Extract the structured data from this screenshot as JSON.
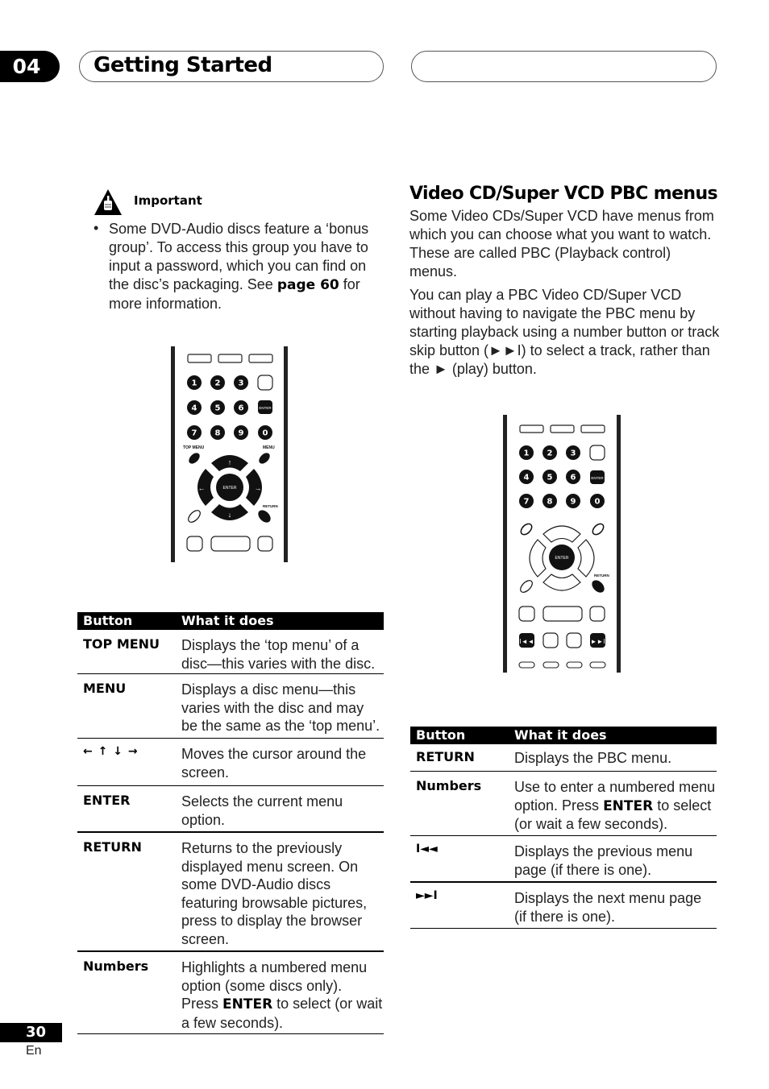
{
  "header": {
    "chapter_number": "04",
    "chapter_title": "Getting Started"
  },
  "important": {
    "icon": "warning-hand-icon",
    "label": "Important",
    "bullet": "•",
    "text_before": "Some DVD-Audio discs feature a ‘bonus group’. To access this group you have to input a password, which you can find on the disc’s packaging. See ",
    "text_bold": "page 60",
    "text_after": " for more information."
  },
  "remote_left": {
    "labels": {
      "top_menu": "TOP MENU",
      "menu": "MENU",
      "enter_small": "ENTER",
      "enter_center": "ENTER",
      "return": "RETURN"
    },
    "number_keys": [
      "1",
      "2",
      "3",
      "4",
      "5",
      "6",
      "7",
      "8",
      "9",
      "0"
    ]
  },
  "table_left": {
    "headers": [
      "Button",
      "What it does"
    ],
    "rows": [
      {
        "button": "TOP MENU",
        "desc": "Displays the ‘top menu’ of a disc—this varies with the disc."
      },
      {
        "button": "MENU",
        "desc": "Displays a disc menu—this varies with the disc and may be the same as the ‘top menu’."
      },
      {
        "button": "← ↑ ↓ →",
        "button_icon": "arrow-keys-icon",
        "desc": "Moves the cursor around the screen."
      },
      {
        "button": "ENTER",
        "desc": "Selects the current menu option."
      },
      {
        "button": "RETURN",
        "desc": "Returns to the previously displayed menu screen. On some DVD-Audio discs featuring browsable pictures, press to display the browser screen."
      },
      {
        "button": "Numbers",
        "desc_before": "Highlights a numbered menu option (some discs only). Press ",
        "desc_bold": "ENTER",
        "desc_after": " to select (or wait a few seconds)."
      }
    ]
  },
  "section": {
    "heading": "Video CD/Super VCD PBC menus",
    "para1": "Some Video CDs/Super VCD have menus from which you can choose what you want to watch. These are called PBC (Playback control) menus.",
    "para2": "You can play a PBC Video CD/Super VCD without having to navigate the PBC menu by starting playback using a number button or track skip button (►►I) to select a track, rather than the ► (play) button."
  },
  "remote_right": {
    "labels": {
      "enter_small": "ENTER",
      "enter_center": "ENTER",
      "return": "RETURN"
    },
    "number_keys": [
      "1",
      "2",
      "3",
      "4",
      "5",
      "6",
      "7",
      "8",
      "9",
      "0"
    ]
  },
  "table_right": {
    "headers": [
      "Button",
      "What it does"
    ],
    "rows": [
      {
        "button": "RETURN",
        "desc": "Displays the PBC menu."
      },
      {
        "button": "Numbers",
        "desc_before": "Use to enter a numbered menu option. Press ",
        "desc_bold": "ENTER",
        "desc_after": " to select (or wait a few seconds)."
      },
      {
        "button": "I◄◄",
        "button_icon": "previous-track-icon",
        "desc": "Displays the previous menu page (if there is one)."
      },
      {
        "button": "►►I",
        "button_icon": "next-track-icon",
        "desc": "Displays the next menu page (if there is one)."
      }
    ]
  },
  "footer": {
    "page_number": "30",
    "language": "En"
  }
}
